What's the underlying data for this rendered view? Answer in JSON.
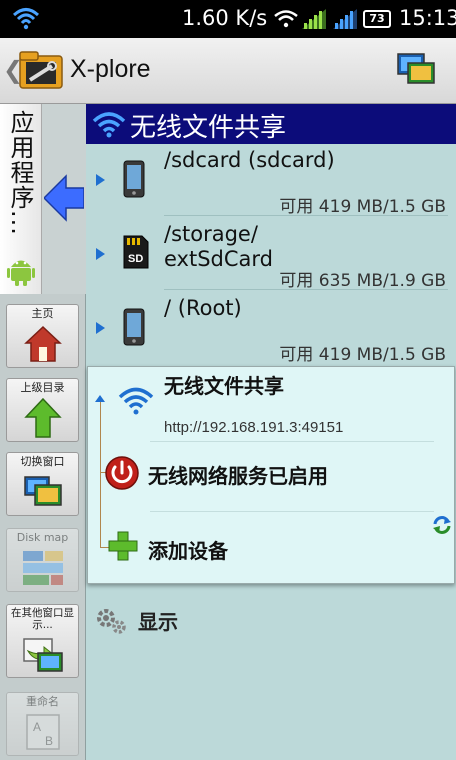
{
  "status_bar": {
    "speed": "1.60 K/s",
    "battery": "73",
    "time": "15:13"
  },
  "title_bar": {
    "back_glyph": "❮",
    "title": "X-plore"
  },
  "left_tab": {
    "label": "应用程序..."
  },
  "tools": [
    {
      "label": "主页",
      "icon": "home-icon"
    },
    {
      "label": "上级目录",
      "icon": "up-arrow-icon"
    },
    {
      "label": "切换窗口",
      "icon": "switch-window-icon"
    },
    {
      "label": "Disk map",
      "icon": "disk-map-icon"
    },
    {
      "label": "在其他窗口显示...",
      "icon": "show-other-window-icon"
    },
    {
      "label": "重命名",
      "icon": "rename-icon"
    }
  ],
  "panel": {
    "header": "无线文件共享",
    "drives": [
      {
        "name": "/sdcard (sdcard)",
        "free": "可用 419 MB/1.5 GB",
        "icon": "phone-icon"
      },
      {
        "name": "/storage/\nextSdCard",
        "free": "可用 635 MB/1.9 GB",
        "icon": "sd-card-icon"
      },
      {
        "name": "/ (Root)",
        "free": "可用 419 MB/1.5 GB",
        "icon": "phone-icon"
      }
    ]
  },
  "popup": {
    "title": "无线文件共享",
    "url": "http://192.168.191.3:49151",
    "status": "无线网络服务已启用",
    "add_device": "添加设备"
  },
  "display_row": {
    "label": "显示"
  },
  "colors": {
    "header_bg": "#0c0c7a",
    "panel_bg": "#bcd9d9",
    "popup_bg": "#dff6f6",
    "accent_blue": "#1f6fd0"
  }
}
